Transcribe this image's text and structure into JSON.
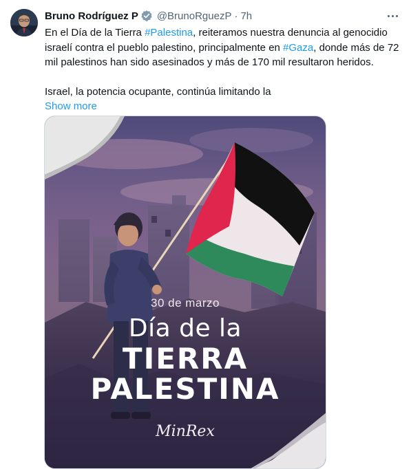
{
  "author": {
    "name": "Bruno Rodríguez P",
    "handle": "@BrunoRguezP",
    "separator": "·",
    "time": "7h"
  },
  "tweet": {
    "seg1": "En el Día de la Tierra ",
    "tag1": "#Palestina",
    "seg2": ", reiteramos nuestra denuncia al genocidio israelí contra el pueblo palestino, principalmente en ",
    "tag2": "#Gaza",
    "seg3": ", donde más de 72 mil palestinos han sido asesinados y más de 170 mil resultaron heridos.",
    "para2": "Israel, la potencia ocupante, continúa limitando la",
    "show_more": "Show more"
  },
  "media": {
    "date_line": "30 de marzo",
    "title_line1": "Día de la",
    "title_line2": "TIERRA",
    "title_line3": "PALESTINA",
    "signature": "MinRex"
  },
  "colors": {
    "link": "#1d9bf0",
    "verified": "#829aab",
    "secondary_text": "#536471",
    "flag_red": "#e0264c",
    "flag_green": "#2e8a5a",
    "flag_black": "#111111"
  },
  "icons": {
    "verified": "verified-badge-icon",
    "more": "more-dots-icon"
  }
}
